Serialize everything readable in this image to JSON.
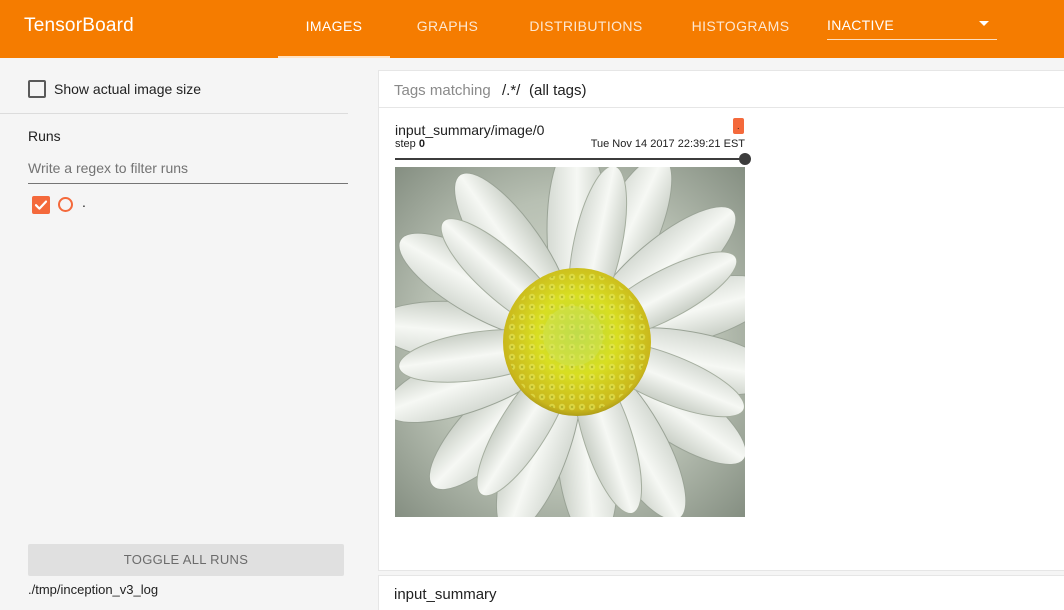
{
  "app": {
    "title": "TensorBoard"
  },
  "nav": {
    "tabs": [
      {
        "label": "IMAGES",
        "active": true
      },
      {
        "label": "GRAPHS",
        "active": false
      },
      {
        "label": "DISTRIBUTIONS",
        "active": false
      },
      {
        "label": "HISTOGRAMS",
        "active": false
      }
    ],
    "inactive_dropdown": {
      "value": "INACTIVE",
      "icon": "caret-down-icon"
    }
  },
  "colors": {
    "brand": "#f57c00",
    "run": "#f4693b"
  },
  "sidebar": {
    "show_actual_size": {
      "label": "Show actual image size",
      "checked": false
    },
    "runs_title": "Runs",
    "regex_placeholder": "Write a regex to filter runs",
    "runs": [
      {
        "name": ".",
        "checked": true
      }
    ],
    "toggle_all_label": "TOGGLE ALL RUNS",
    "logdir": "./tmp/inception_v3_log"
  },
  "main": {
    "tags_bar": {
      "prefix": "Tags matching",
      "pattern": "/.*/",
      "suffix": "(all tags)"
    },
    "image_card": {
      "tag": "input_summary/image/0",
      "run_badge": ".",
      "step_label": "step",
      "step_value": "0",
      "timestamp": "Tue Nov 14 2017 22:39:21 EST",
      "image_subject": "white-daisy-flower"
    },
    "section_title": "input_summary"
  }
}
